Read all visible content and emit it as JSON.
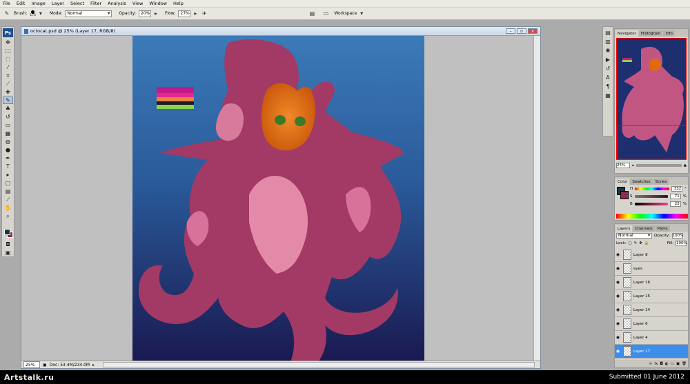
{
  "menu": [
    "File",
    "Edit",
    "Image",
    "Layer",
    "Select",
    "Filter",
    "Analysis",
    "View",
    "Window",
    "Help"
  ],
  "options": {
    "brush_label": "Brush:",
    "brush_size": "175",
    "mode_label": "Mode:",
    "mode_value": "Normal",
    "opacity_label": "Opacity:",
    "opacity_value": "20%",
    "flow_label": "Flow:",
    "flow_value": "27%",
    "workspace_label": "Workspace"
  },
  "document": {
    "title": "octocat.psd @ 25% (Layer 17, RGB/8)",
    "zoom": "25%",
    "doc_size": "Doc: 53.4M/234.0M"
  },
  "navigator": {
    "tabs": [
      "Navigator",
      "Histogram",
      "Info"
    ],
    "zoom": "25%"
  },
  "color": {
    "tabs": [
      "Color",
      "Swatches",
      "Styles"
    ],
    "rows": [
      {
        "label": "H",
        "value": "332",
        "unit": "°"
      },
      {
        "label": "S",
        "value": "71",
        "unit": "%"
      },
      {
        "label": "B",
        "value": "25",
        "unit": "%"
      }
    ]
  },
  "layers": {
    "tabs": [
      "Layers",
      "Channels",
      "Paths"
    ],
    "blend": "Normal",
    "opacity_label": "Opacity:",
    "opacity": "100%",
    "lock_label": "Lock:",
    "fill_label": "Fill:",
    "fill": "100%",
    "items": [
      {
        "name": "Layer 8"
      },
      {
        "name": "eyes"
      },
      {
        "name": "Layer 16"
      },
      {
        "name": "Layer 15"
      },
      {
        "name": "Layer 14"
      },
      {
        "name": "Layer 6"
      },
      {
        "name": "Layer 4"
      },
      {
        "name": "Layer 17"
      }
    ]
  },
  "footer": {
    "logo": "Artstalk.ru",
    "submitted": "Submitted 01 June 2012"
  },
  "colors": {
    "canvas_top": "#3c7ab8",
    "canvas_bottom": "#1a1950",
    "octopus": "#a23a65",
    "octopus_light": "#e38aa8",
    "cat": "#e06a10",
    "selected_layer": "#3d8eea"
  }
}
